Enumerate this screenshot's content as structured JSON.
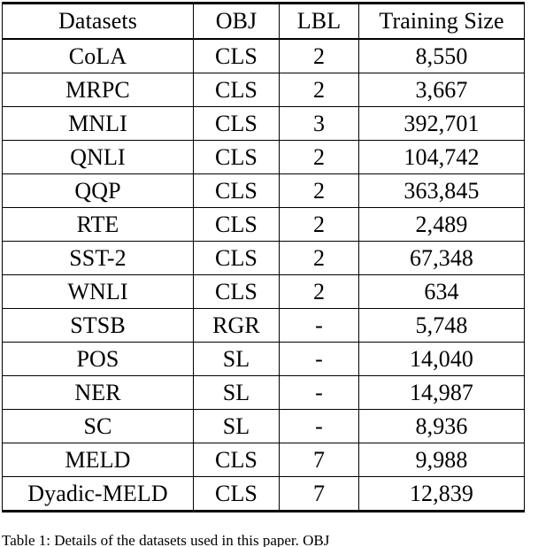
{
  "document": {
    "kind": "paper-table-figure",
    "background_color": "#ffffff",
    "text_color": "#000000"
  },
  "table": {
    "columns": [
      "Datasets",
      "OBJ",
      "LBL",
      "Training Size"
    ],
    "rows": [
      {
        "dataset": "CoLA",
        "obj": "CLS",
        "lbl": "2",
        "size": "8,550"
      },
      {
        "dataset": "MRPC",
        "obj": "CLS",
        "lbl": "2",
        "size": "3,667"
      },
      {
        "dataset": "MNLI",
        "obj": "CLS",
        "lbl": "3",
        "size": "392,701"
      },
      {
        "dataset": "QNLI",
        "obj": "CLS",
        "lbl": "2",
        "size": "104,742"
      },
      {
        "dataset": "QQP",
        "obj": "CLS",
        "lbl": "2",
        "size": "363,845"
      },
      {
        "dataset": "RTE",
        "obj": "CLS",
        "lbl": "2",
        "size": "2,489"
      },
      {
        "dataset": "SST-2",
        "obj": "CLS",
        "lbl": "2",
        "size": "67,348"
      },
      {
        "dataset": "WNLI",
        "obj": "CLS",
        "lbl": "2",
        "size": "634"
      },
      {
        "dataset": "STSB",
        "obj": "RGR",
        "lbl": "-",
        "size": "5,748"
      },
      {
        "dataset": "POS",
        "obj": "SL",
        "lbl": "-",
        "size": "14,040"
      },
      {
        "dataset": "NER",
        "obj": "SL",
        "lbl": "-",
        "size": "14,987"
      },
      {
        "dataset": "SC",
        "obj": "SL",
        "lbl": "-",
        "size": "8,936"
      },
      {
        "dataset": "MELD",
        "obj": "CLS",
        "lbl": "7",
        "size": "9,988"
      },
      {
        "dataset": "Dyadic-MELD",
        "obj": "CLS",
        "lbl": "7",
        "size": "12,839"
      }
    ]
  },
  "caption": {
    "label": "Table 1:",
    "text": " Details of the datasets used in this paper. OBJ"
  }
}
